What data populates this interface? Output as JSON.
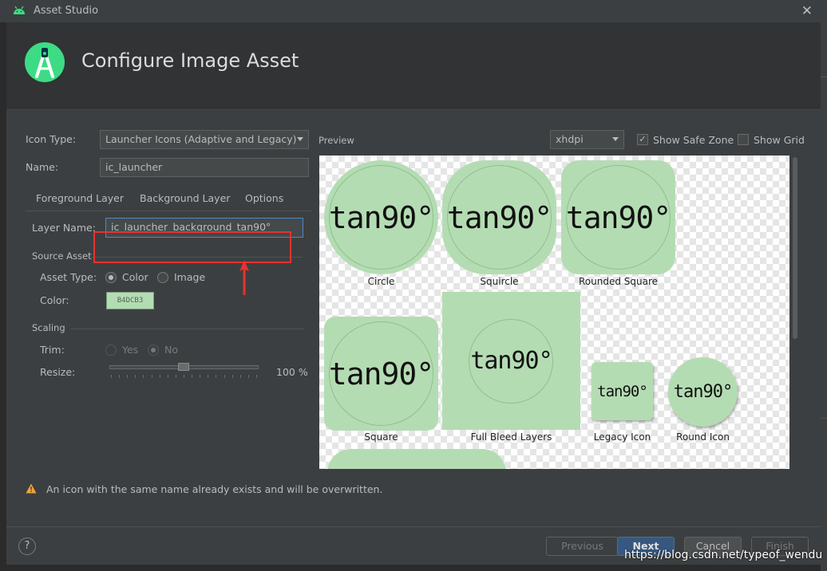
{
  "window": {
    "title": "Asset Studio",
    "close_glyph": "✕"
  },
  "header": {
    "title": "Configure Image Asset"
  },
  "form": {
    "icon_type_label": "Icon Type:",
    "icon_type_value": "Launcher Icons (Adaptive and Legacy)",
    "name_label": "Name:",
    "name_value": "ic_launcher",
    "tabs": [
      "Foreground Layer",
      "Background Layer",
      "Options"
    ],
    "layer_name_label": "Layer Name:",
    "layer_name_value": "ic_launcher_background_tan90°",
    "source_asset_label": "Source Asset",
    "asset_type_label": "Asset Type:",
    "asset_type_options": [
      "Color",
      "Image"
    ],
    "asset_type_selected": "Color",
    "color_label": "Color:",
    "color_value": "B4DCB3",
    "color_hex": "#b4dcb3",
    "scaling_label": "Scaling",
    "trim_label": "Trim:",
    "trim_options": [
      "Yes",
      "No"
    ],
    "trim_selected": "No",
    "resize_label": "Resize:",
    "resize_value": "100 %",
    "resize_fraction": 1.0
  },
  "preview": {
    "label": "Preview",
    "density": "xhdpi",
    "show_safe_zone_label": "Show Safe Zone",
    "show_safe_zone": true,
    "show_grid_label": "Show Grid",
    "show_grid": false,
    "icon_text": "tan90°",
    "tiles": [
      "Circle",
      "Squircle",
      "Rounded Square",
      "Square",
      "Full Bleed Layers",
      "Legacy Icon",
      "Round Icon"
    ]
  },
  "warning": {
    "icon": "warning-triangle-icon",
    "text": "An icon with the same name already exists and will be overwritten."
  },
  "buttons": {
    "help": "?",
    "previous": "Previous",
    "next": "Next",
    "cancel": "Cancel",
    "finish": "Finish"
  },
  "watermark": "https://blog.csdn.net/typeof_wendu"
}
